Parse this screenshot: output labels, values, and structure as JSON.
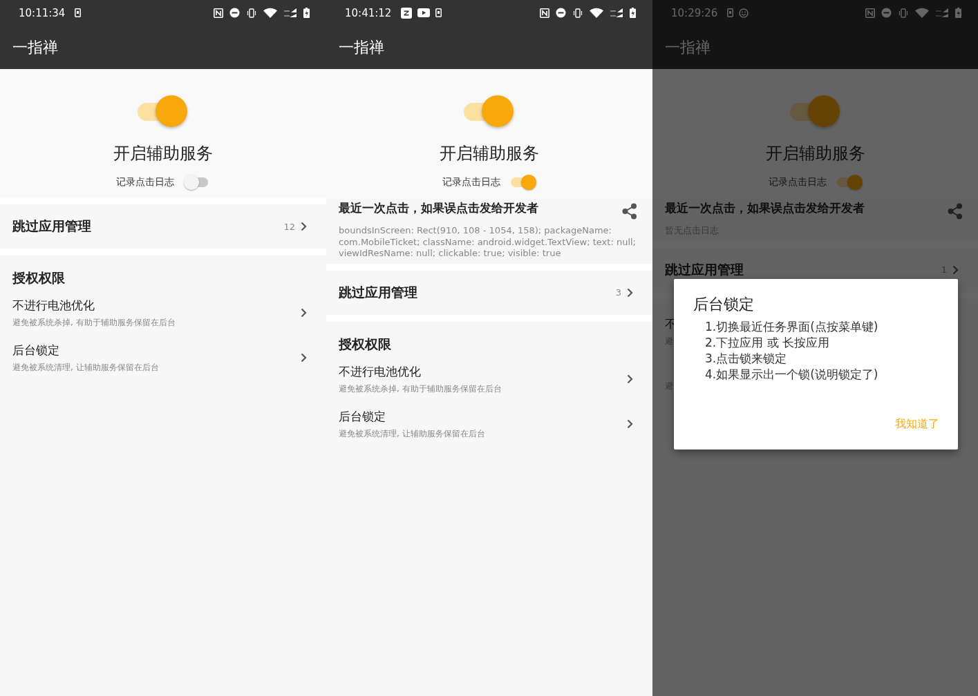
{
  "screens": [
    {
      "status_bar": {
        "time": "10:11:34",
        "notification_icons": [
          {
            "kind": "screenshot"
          }
        ]
      },
      "app_bar": {
        "title": "一指禅"
      },
      "service_switch": {
        "on": true
      },
      "service_title": "开启辅助服务",
      "log_switch": {
        "label": "记录点击日志",
        "on": false
      },
      "skip_apps": {
        "label": "跳过应用管理",
        "count": "12"
      },
      "permissions": {
        "heading": "授权权限",
        "items": [
          {
            "title": "不进行电池优化",
            "subtitle": "避免被系统杀掉, 有助于辅助服务保留在后台"
          },
          {
            "title": "后台锁定",
            "subtitle": "避免被系统清理, 让辅助服务保留在后台"
          }
        ]
      }
    },
    {
      "status_bar": {
        "time": "10:41:12",
        "notification_icons": [
          {
            "kind": "letter-app"
          },
          {
            "kind": "video"
          },
          {
            "kind": "screenshot"
          }
        ]
      },
      "app_bar": {
        "title": "一指禅"
      },
      "service_switch": {
        "on": true
      },
      "service_title": "开启辅助服务",
      "log_switch": {
        "label": "记录点击日志",
        "on": true
      },
      "last_click": {
        "heading": "最近一次点击，如果误点击发给开发者",
        "text": "boundsInScreen: Rect(910, 108 - 1054, 158); packageName: com.MobileTicket; className: android.widget.TextView; text: null; viewIdResName: null; clickable: true; visible: true"
      },
      "skip_apps": {
        "label": "跳过应用管理",
        "count": "3"
      },
      "permissions": {
        "heading": "授权权限",
        "items": [
          {
            "title": "不进行电池优化",
            "subtitle": "避免被系统杀掉, 有助于辅助服务保留在后台"
          },
          {
            "title": "后台锁定",
            "subtitle": "避免被系统清理, 让辅助服务保留在后台"
          }
        ]
      }
    },
    {
      "status_bar": {
        "time": "10:29:26",
        "notification_icons": [
          {
            "kind": "screenshot"
          },
          {
            "kind": "smiley"
          }
        ]
      },
      "app_bar": {
        "title": "一指禅"
      },
      "service_switch": {
        "on": true
      },
      "service_title": "开启辅助服务",
      "log_switch": {
        "label": "记录点击日志",
        "on": true
      },
      "last_click": {
        "heading": "最近一次点击，如果误点击发给开发者",
        "text": "暂无点击日志"
      },
      "skip_apps": {
        "label": "跳过应用管理",
        "count": "1"
      },
      "permissions": {
        "items": [
          {
            "title": "不",
            "subtitle": "避"
          },
          {
            "subtitle": "避"
          }
        ]
      },
      "dialog": {
        "title": "后台锁定",
        "lines": [
          "1.切换最近任务界面(点按菜单键)",
          "2.下拉应用 或 长按应用",
          "3.点击锁来锁定",
          "4.如果显示出一个锁(说明锁定了)"
        ],
        "button": "我知道了"
      }
    }
  ]
}
